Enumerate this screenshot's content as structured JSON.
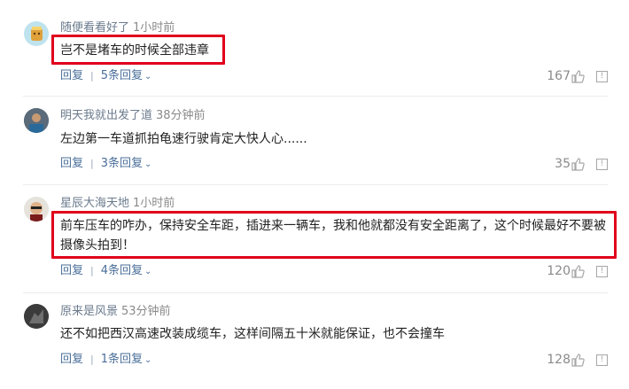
{
  "comments": [
    {
      "username": "随便看看好了",
      "time": "1小时前",
      "text": "岂不是堵车的时候全部违章",
      "reply_label": "回复",
      "replies_label": "5条回复",
      "likes": "167"
    },
    {
      "username": "明天我就出发了道",
      "time": "38分钟前",
      "text": "左边第一车道抓拍龟速行驶肯定大快人心......",
      "reply_label": "回复",
      "replies_label": "3条回复",
      "likes": "35"
    },
    {
      "username": "星辰大海天地",
      "time": "1小时前",
      "text": "前车压车的咋办，保持安全车距，插进来一辆车，我和他就都没有安全距离了，这个时候最好不要被摄像头拍到！",
      "reply_label": "回复",
      "replies_label": "4条回复",
      "likes": "120"
    },
    {
      "username": "原来是风景",
      "time": "53分钟前",
      "text": "还不如把西汉高速改装成缆车，这样间隔五十米就能保证，也不会撞车",
      "reply_label": "回复",
      "replies_label": "1条回复",
      "likes": "128"
    }
  ],
  "colors": {
    "highlight": "#e0001b",
    "link": "#4a6f9a",
    "username": "#6a7a8c"
  }
}
